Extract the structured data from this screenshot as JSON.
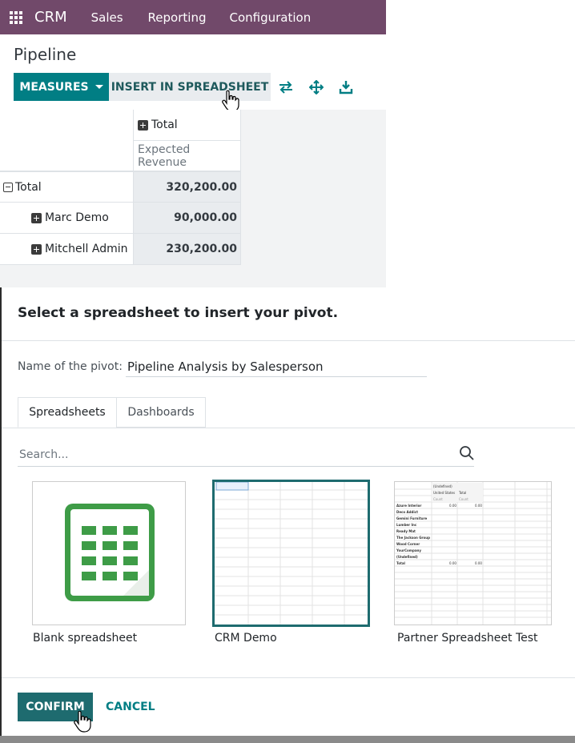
{
  "navbar": {
    "brand": "CRM",
    "menu": [
      "Sales",
      "Reporting",
      "Configuration"
    ]
  },
  "control_panel": {
    "title": "Pipeline",
    "measures_label": "MEASURES",
    "insert_label": "INSERT IN SPREADSHEET",
    "icons": [
      "flip-axis-icon",
      "expand-all-icon",
      "download-icon"
    ]
  },
  "pivot": {
    "col_header": "Total",
    "measure": "Expected Revenue",
    "rows": [
      {
        "label": "Total",
        "value": "320,200.00"
      },
      {
        "label": "Marc Demo",
        "value": "90,000.00"
      },
      {
        "label": "Mitchell Admin",
        "value": "230,200.00"
      }
    ]
  },
  "dialog": {
    "title": "Select a spreadsheet to insert your pivot.",
    "name_label": "Name of the pivot:",
    "name_value": "Pipeline Analysis by Salesperson",
    "tabs": [
      "Spreadsheets",
      "Dashboards"
    ],
    "search_placeholder": "Search...",
    "cards": [
      {
        "label": "Blank spreadsheet"
      },
      {
        "label": "CRM Demo"
      },
      {
        "label": "Partner Spreadsheet Test"
      }
    ],
    "confirm_label": "CONFIRM",
    "cancel_label": "CANCEL"
  },
  "thumbnail_partner": {
    "header_row": [
      "(Undefined)"
    ],
    "sub_header": [
      "United States",
      "Total"
    ],
    "measure_row": [
      "Count",
      "Count"
    ],
    "rows": [
      "Azure Interior",
      "Deco Addict",
      "Gemini Furniture",
      "Lumber Inc",
      "Ready Mat",
      "The Jackson Group",
      "Wood Corner",
      "YourCompany",
      "(Undefined)",
      "Total"
    ],
    "values": [
      "0.00",
      "0.00"
    ]
  },
  "colors": {
    "navbar": "#71496a",
    "primary": "#017e84",
    "spreadsheet_green": "#3e9c47"
  }
}
